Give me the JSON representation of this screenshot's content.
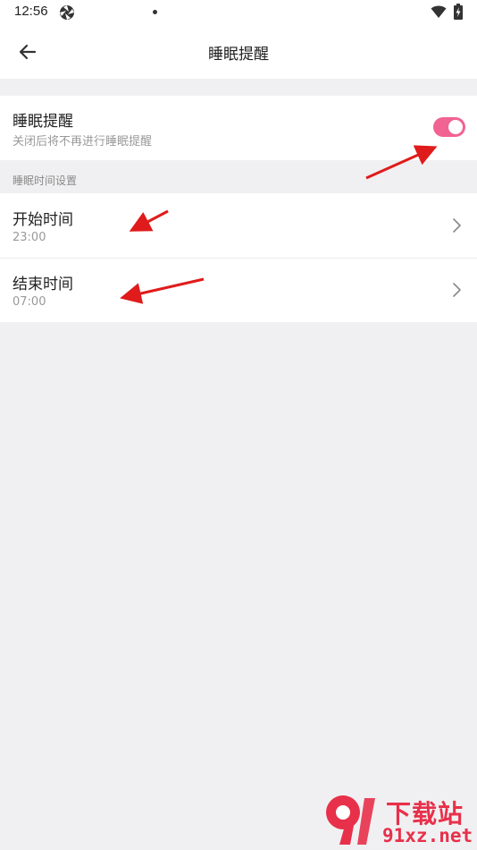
{
  "status_bar": {
    "time": "12:56",
    "icons": [
      "aperture-icon",
      "dot-icon",
      "wifi-icon",
      "battery-charging-icon"
    ]
  },
  "app_bar": {
    "back_icon": "arrow-left-icon",
    "title": "睡眠提醒"
  },
  "reminder": {
    "title": "睡眠提醒",
    "subtitle": "关闭后将不再进行睡眠提醒",
    "enabled": true,
    "toggle_color": "#f06393"
  },
  "section": {
    "label": "睡眠时间设置"
  },
  "time_settings": [
    {
      "title": "开始时间",
      "value": "23:00",
      "icon": "chevron-right-icon"
    },
    {
      "title": "结束时间",
      "value": "07:00",
      "icon": "chevron-right-icon"
    }
  ],
  "annotations": {
    "arrow_color": "#e01b1b"
  },
  "watermark": {
    "line1": "下载站",
    "line2": "91xz.net",
    "color": "#e8304a"
  }
}
